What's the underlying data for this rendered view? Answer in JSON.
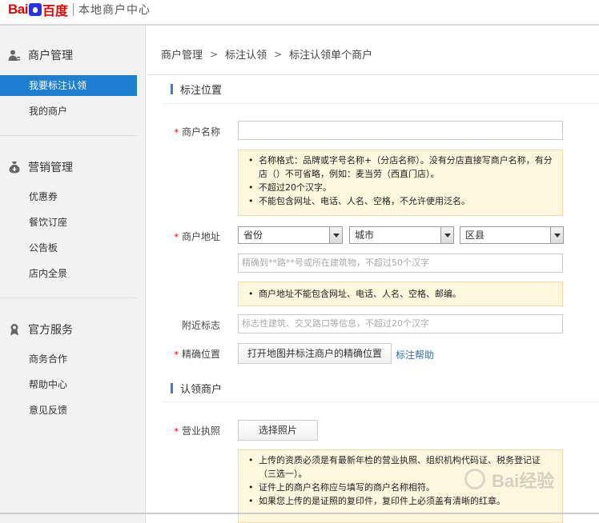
{
  "header": {
    "logo_bai": "Bai",
    "logo_du": "百度",
    "subtitle": "本地商户中心"
  },
  "sidebar": {
    "groups": [
      {
        "title": "商户管理",
        "icon": "user-icon",
        "items": [
          "我要标注认领",
          "我的商户"
        ]
      },
      {
        "title": "营销管理",
        "icon": "money-bag-icon",
        "items": [
          "优惠券",
          "餐饮订座",
          "公告板",
          "店内全景"
        ]
      },
      {
        "title": "官方服务",
        "icon": "badge-icon",
        "items": [
          "商务合作",
          "帮助中心",
          "意见反馈"
        ]
      }
    ],
    "active_item": "我要标注认领"
  },
  "breadcrumb": [
    "商户管理",
    "标注认领",
    "标注认领单个商户"
  ],
  "section_location": {
    "title": "标注位置",
    "merchant_name_label": "商户名称",
    "merchant_name_value": "",
    "name_tips": [
      "名称格式：品牌或字号名称+（分店名称）。没有分店直接写商户名称，有分店（）不可省略，例如：麦当劳（西直门店）。",
      "不超过20个汉字。",
      "不能包含网址、电话、人名、空格，不允许使用泛名。"
    ],
    "address_label": "商户地址",
    "province": "省份",
    "city": "城市",
    "district": "区县",
    "address_placeholder": "精确到**路**号或所在建筑物，不超过50个汉字",
    "address_tips": [
      "商户地址不能包含网址、电话、人名、空格、邮编。"
    ],
    "landmark_label": "附近标志",
    "landmark_placeholder": "标志性建筑、交叉路口等信息，不超过20个汉字",
    "location_label": "精确位置",
    "open_map_button": "打开地图并标注商户的精确位置",
    "help_link": "标注帮助"
  },
  "section_claim": {
    "title": "认领商户",
    "license_label": "营业执照",
    "select_photo_button": "选择照片",
    "license_tips": [
      "上传的资质必须是有最新年检的营业执照、组织机构代码证、税务登记证（三选一）。",
      "证件上的商户名称应与填写的商户名称相符。",
      "如果您上传的是证照的复印件，复印件上必须盖有清晰的红章。"
    ]
  },
  "watermark": "Bai经验",
  "colors": {
    "accent": "#1e7fd1",
    "required": "#dd0000",
    "tip_bg": "#fff7dd",
    "link": "#2f6fae"
  }
}
